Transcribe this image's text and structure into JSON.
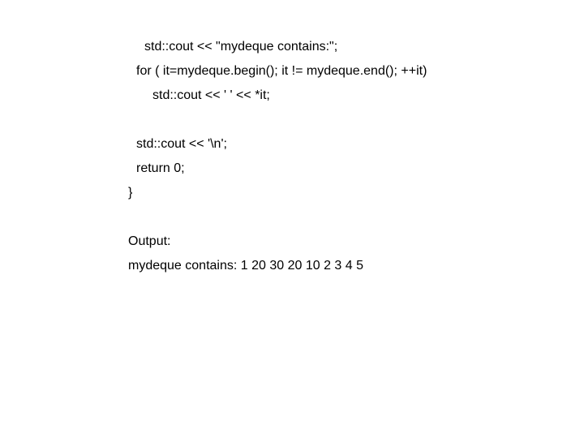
{
  "code": {
    "l1": "std::cout << \"mydeque contains:\";",
    "l2": "for ( it=mydeque.begin(); it != mydeque.end(); ++it)",
    "l3": "std::cout << ' ' << *it;",
    "l4": "std::cout << '\\n';",
    "l5": "return 0;",
    "l6": "}"
  },
  "output": {
    "label": "Output:",
    "text": "mydeque contains: 1 20 30 20 10 2 3 4 5"
  }
}
